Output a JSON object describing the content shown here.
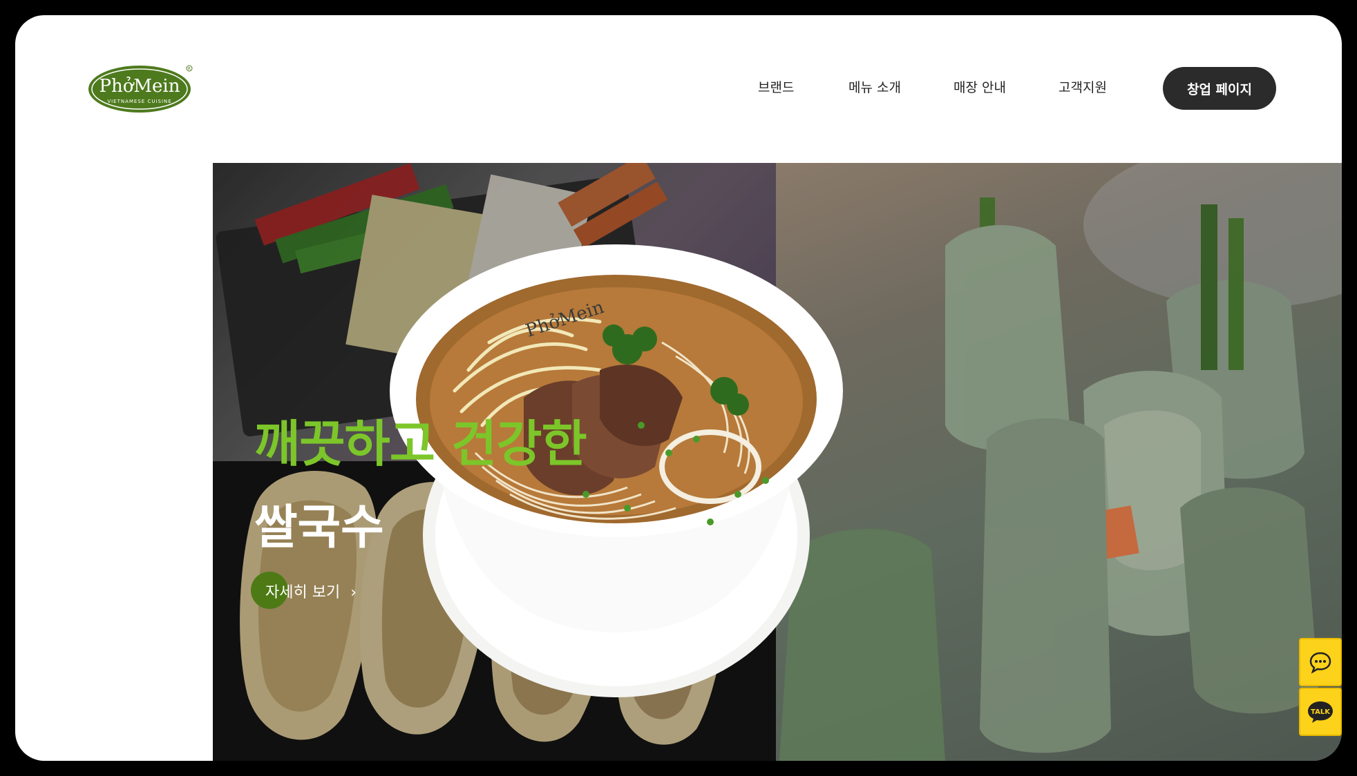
{
  "brand": {
    "logo_text": "PhởMein",
    "logo_sub": "VIETNAMESE CUISINE",
    "logo_color": "#4e7a1e"
  },
  "nav": {
    "items": [
      "브랜드",
      "메뉴 소개",
      "매장 안내",
      "고객지원"
    ],
    "cta": "창업 페이지"
  },
  "hero": {
    "headline": "깨끗하고 건강한",
    "subhead": "쌀국수",
    "more_label": "자세히 보기",
    "more_arrow": "›",
    "headline_color": "#7cc62a",
    "bowl_brand": "PhởMein"
  },
  "floating": {
    "chat_icon": "chat-bubble-icon",
    "talk_label": "TALK"
  }
}
